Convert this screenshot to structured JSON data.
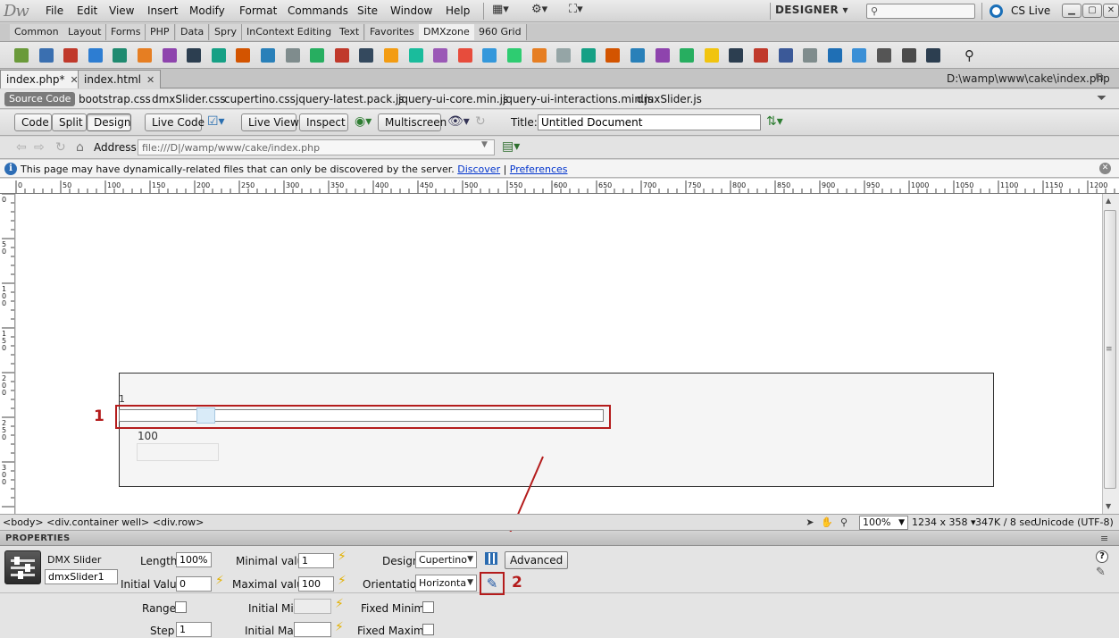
{
  "app": {
    "logo": "Dw",
    "menus": [
      "File",
      "Edit",
      "View",
      "Insert",
      "Modify",
      "Format",
      "Commands",
      "Site",
      "Window",
      "Help"
    ],
    "workspace": "DESIGNER",
    "cslive": "CS Live"
  },
  "insert_tabs": [
    "Common",
    "Layout",
    "Forms",
    "PHP",
    "Data",
    "Spry",
    "InContext Editing",
    "Text",
    "Favorites",
    "DMXzone",
    "960 Grid"
  ],
  "insert_tabs_active": "DMXzone",
  "doc_tabs": [
    {
      "label": "index.php*",
      "active": true
    },
    {
      "label": "index.html",
      "active": false
    }
  ],
  "doc_path": "D:\\wamp\\www\\cake\\index.php",
  "related_files": {
    "source": "Source Code",
    "files": [
      "bootstrap.css",
      "dmxSlider.css",
      "cupertino.css",
      "jquery-latest.pack.js",
      "jquery-ui-core.min.js",
      "jquery-ui-interactions.min.js",
      "dmxSlider.js"
    ]
  },
  "doc_toolbar": {
    "code": "Code",
    "split": "Split",
    "design": "Design",
    "live_code": "Live Code",
    "live_view": "Live View",
    "inspect": "Inspect",
    "multiscreen": "Multiscreen",
    "title_label": "Title:",
    "title_value": "Untitled Document"
  },
  "address": {
    "label": "Address:",
    "value": "file:///D|/wamp/www/cake/index.php"
  },
  "infobar": {
    "message": "This page may have dynamically-related files that can only be discovered by the server.",
    "discover": "Discover",
    "preferences": "Preferences"
  },
  "ruler": {
    "h_ticks": [
      "0",
      "50",
      "100",
      "150",
      "200",
      "250",
      "300",
      "350",
      "400",
      "450",
      "500",
      "550",
      "600",
      "650",
      "700",
      "750",
      "800",
      "850",
      "900",
      "950",
      "1000",
      "1050",
      "1100",
      "1150",
      "1200"
    ],
    "v_ticks": [
      "0",
      "50",
      "100",
      "150",
      "200",
      "250",
      "300"
    ]
  },
  "canvas": {
    "slider_min_label": "1",
    "slider_max_label": "100",
    "slider_handle_fraction": 0.16,
    "annotation_1": "1",
    "annotation_2": "2"
  },
  "status": {
    "tags": "<body> <div.container well> <div.row>",
    "zoom": "100%",
    "dimensions": "1234 x 358",
    "size": "347K / 8 sec",
    "encoding": "Unicode (UTF-8)"
  },
  "properties": {
    "title": "PROPERTIES",
    "widget_type": "DMX Slider",
    "widget_id": "dmxSlider1",
    "length_label": "Length",
    "length_value": "100%",
    "initial_value_label": "Initial Value",
    "initial_value": "0",
    "min_label": "Minimal value",
    "min_value": "1",
    "max_label": "Maximal value",
    "max_value": "100",
    "design_label": "Design",
    "design_value": "Cupertino",
    "advanced": "Advanced",
    "orientation_label": "Orientation",
    "orientation_value": "Horizonta",
    "range_label": "Range",
    "initial_min_label": "Initial Min",
    "fixed_minimal_label": "Fixed Minimal",
    "step_label": "Step",
    "step_value": "1",
    "initial_max_label": "Initial Max",
    "fixed_maximal_label": "Fixed Maximal"
  },
  "colors": {
    "annotation_red": "#b41c1c",
    "accent_blue": "#1f56a3"
  }
}
